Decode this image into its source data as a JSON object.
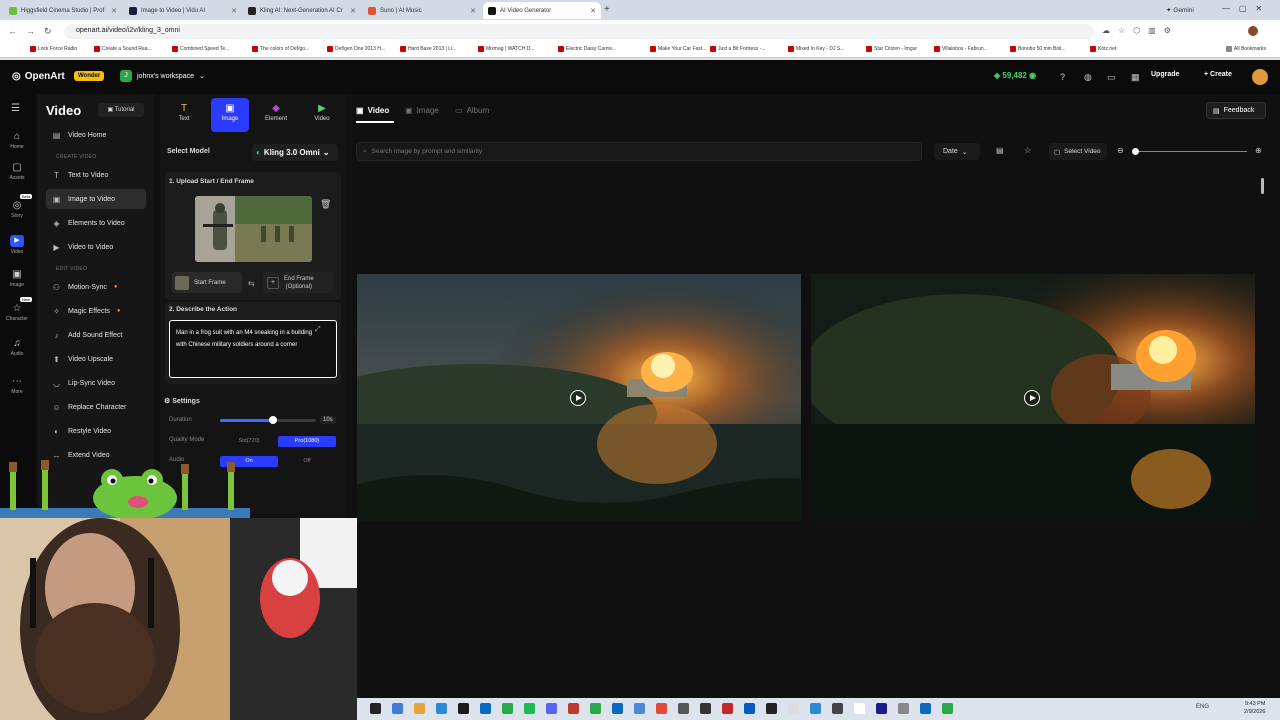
{
  "browser": {
    "tabs": [
      {
        "title": "Higgsfield Cinema Studio | Prof",
        "color": "#6bbf3a"
      },
      {
        "title": "Image to Video | Vidu AI",
        "color": "#1a1a40"
      },
      {
        "title": "Kling AI: Next-Generation AI Cr",
        "color": "#222"
      },
      {
        "title": "Suno | AI Music",
        "color": "#e0553a"
      },
      {
        "title": "AI Video Generator",
        "color": "#111"
      }
    ],
    "new_tab_label": "+",
    "gemini_label": "Gemini",
    "url": "openart.ai/video/i2v/kling_3_omni",
    "bookmarks": [
      "Lock Force Radio",
      "Create a Sound Rea...",
      "Combined Speed Te...",
      "The colors of Def/go...",
      "Def/gen One 2013 H...",
      "Hard Base 2013 | Li...",
      "Mixmag | WATCH D...",
      "Electric Daisy Carniv...",
      "Make Your Car Fast...",
      "Just a Bit Fortress -...",
      "Mixed In Key - DJ S...",
      "Star Citizen - Imgur",
      "Villalobos - Fabrun...",
      "Bonobo 50 min Boil...",
      "Kotz.net"
    ],
    "all_bookmarks": "All Bookmarks"
  },
  "header": {
    "logo": "OpenArt",
    "plan_badge": "Wonder",
    "workspace_initial": "J",
    "workspace": "johnx's workspace",
    "credits": "59,482",
    "upgrade": "Upgrade",
    "create": "Create"
  },
  "rail": [
    {
      "label": "Home",
      "icon": "⌂"
    },
    {
      "label": "Assets",
      "icon": "▢"
    },
    {
      "label": "Story",
      "icon": "◎",
      "badge": "Beta"
    },
    {
      "label": "Video",
      "icon": "▶"
    },
    {
      "label": "Image",
      "icon": "▣"
    },
    {
      "label": "Character",
      "icon": "☆",
      "badge": "New"
    },
    {
      "label": "Audio",
      "icon": "♫"
    },
    {
      "label": "More",
      "icon": "⋯"
    }
  ],
  "nav": {
    "title": "Video",
    "tutorial": "Tutorial",
    "home": "Video Home",
    "create_section": "CREATE VIDEO",
    "create_items": [
      "Text to Video",
      "Image to Video",
      "Elements to Video",
      "Video to Video"
    ],
    "edit_section": "EDIT VIDEO",
    "edit_items": [
      "Motion-Sync",
      "Magic Effects",
      "Add Sound Effect",
      "Video Upscale",
      "Lip-Sync Video",
      "Replace Character",
      "Restyle Video",
      "Extend Video"
    ]
  },
  "panel": {
    "tabs": [
      "Text",
      "Image",
      "Element",
      "Video"
    ],
    "select_model": "Select Model",
    "model": "Kling 3.0 Omni",
    "step1": "1. Upload Start / End Frame",
    "start_frame": "Start Frame",
    "end_frame_1": "End Frame",
    "end_frame_2": "(Optional)",
    "step2": "2. Describe the Action",
    "prompt": "Man in a frog suit with an M4 sneaking in a building with Chinese military soldiers around a corner",
    "settings": "Settings",
    "duration_label": "Duration",
    "duration_value": "10s",
    "duration_fraction": 0.55,
    "quality_label": "Quality Mode",
    "quality_options": [
      "Std(720)",
      "Pro(1080)"
    ],
    "audio_label": "Audio",
    "audio_options": [
      "On",
      "Off"
    ]
  },
  "content": {
    "tabs": [
      "Video",
      "Image",
      "Album"
    ],
    "feedback": "Feedback",
    "search_placeholder": "Search image by prompt and similarity",
    "date": "Date",
    "select_video": "Select Video"
  },
  "taskbar": {
    "lang": "ENG",
    "time": "9:43 PM",
    "date": "2/9/2026"
  },
  "colors": {
    "accent": "#2a3cff",
    "credits": "#46d36a",
    "wonder": "#f4c20d"
  }
}
